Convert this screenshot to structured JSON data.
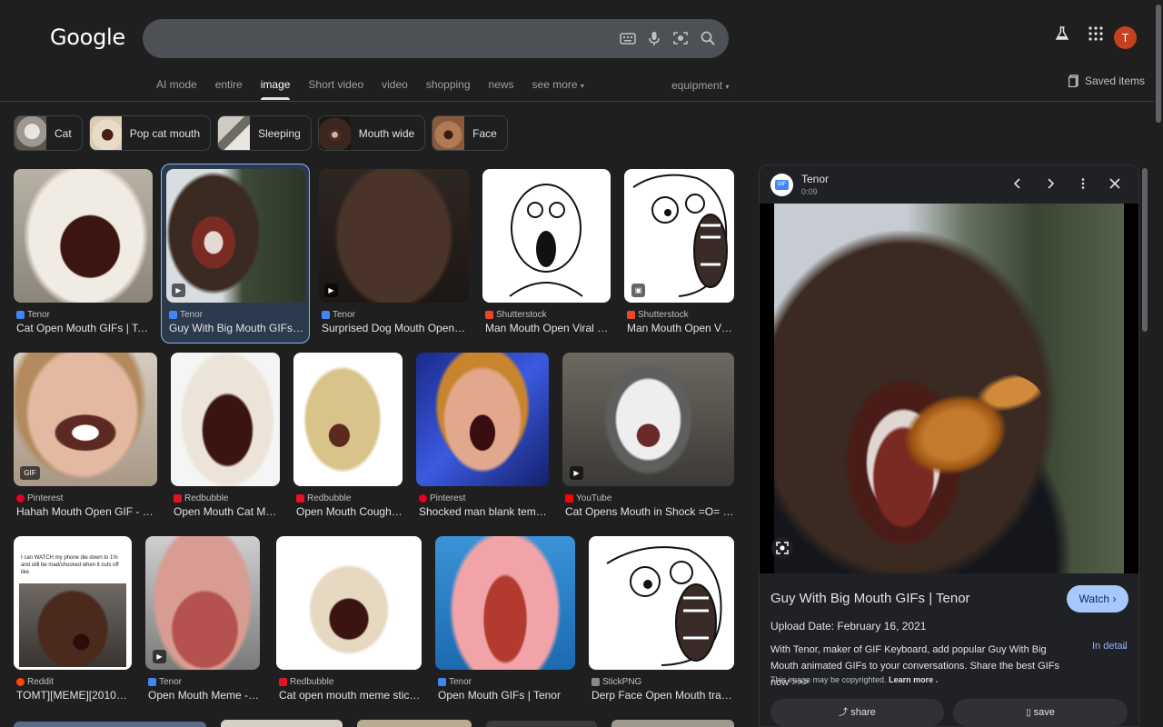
{
  "header": {
    "logo": "Google",
    "tabs": [
      "AI mode",
      "entire",
      "image",
      "Short video",
      "video",
      "shopping",
      "news",
      "see more"
    ],
    "active_tab": "image",
    "tools_label": "equipment",
    "saved_label": "Saved items",
    "avatar_letter": "T"
  },
  "chips": [
    {
      "label": "Cat"
    },
    {
      "label": "Pop cat mouth"
    },
    {
      "label": "Sleeping"
    },
    {
      "label": "Mouth wide"
    },
    {
      "label": "Face"
    }
  ],
  "results": {
    "row1": [
      {
        "source": "Tenor",
        "title": "Cat Open Mouth GIFs | Tenor"
      },
      {
        "source": "Tenor",
        "title": "Guy With Big Mouth GIFs | ..."
      },
      {
        "source": "Tenor",
        "title": "Surprised Dog Mouth Open M..."
      },
      {
        "source": "Shutterstock",
        "title": "Man Mouth Open Viral M..."
      },
      {
        "source": "Shutterstock",
        "title": "Man Mouth Open Vir..."
      }
    ],
    "row2": [
      {
        "source": "Pinterest",
        "title": "Hahah Mouth Open GIF - Ha...",
        "badge": "GIF"
      },
      {
        "source": "Redbubble",
        "title": "Open Mouth Cat Me..."
      },
      {
        "source": "Redbubble",
        "title": "Open Mouth Cough ..."
      },
      {
        "source": "Pinterest",
        "title": "Shocked man blank template"
      },
      {
        "source": "YouTube",
        "title": "Cat Opens Mouth in Shock =O= - Y..."
      }
    ],
    "row3": [
      {
        "source": "Reddit",
        "title": "TOMT][MEME][2010s] ...",
        "tweet_text": "I can WATCH my phone die down to 1% and still be mad/shocked when it cuts off like"
      },
      {
        "source": "Tenor",
        "title": "Open Mouth Meme - O..."
      },
      {
        "source": "Redbubble",
        "title": "Cat open mouth meme sticke..."
      },
      {
        "source": "Tenor",
        "title": "Open Mouth GIFs | Tenor"
      },
      {
        "source": "StickPNG",
        "title": "Derp Face Open Mouth trans..."
      }
    ]
  },
  "panel": {
    "source": "Tenor",
    "duration": "0:09",
    "title": "Guy With Big Mouth GIFs | Tenor",
    "watch_label": "Watch",
    "upload_date": "Upload Date: February 16, 2021",
    "description": "With Tenor, maker of GIF Keyboard, add popular Guy With Big Mouth animated GIFs to your conversations. Share the best GIFs now >>>",
    "in_detail": "In detail",
    "copyright": "This image may be copyrighted.",
    "learn_more": "Learn more .",
    "share_label": "share",
    "save_label": "save"
  },
  "colors": {
    "background": "#1f1f1f",
    "accent": "#8ab4f8",
    "watch_button": "#a8c7fa",
    "avatar": "#c5411f"
  },
  "icons": [
    "keyboard-icon",
    "mic-icon",
    "lens-icon",
    "search-icon",
    "labs-icon",
    "apps-icon",
    "bookmark-icon",
    "prev-icon",
    "next-icon",
    "more-icon",
    "close-icon",
    "play-icon",
    "share-icon",
    "save-icon"
  ]
}
